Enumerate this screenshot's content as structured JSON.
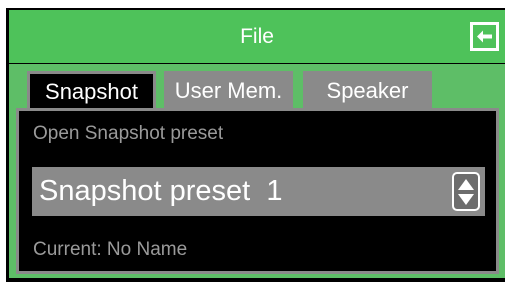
{
  "window": {
    "title": "File"
  },
  "header": {
    "back_icon": "back-arrow-icon"
  },
  "tabs": [
    {
      "label": "Snapshot",
      "active": true
    },
    {
      "label": "User Mem.",
      "active": false
    },
    {
      "label": "Speaker",
      "active": false
    }
  ],
  "panel": {
    "caption": "Open Snapshot preset",
    "preset_value": "Snapshot preset  1",
    "spinner_icon": "up-down-spinner-icon",
    "current_text": "Current: No Name"
  },
  "colors": {
    "header_green": "#4ec25a",
    "panel_gray": "#8a8a8a",
    "background_black": "#000000"
  }
}
